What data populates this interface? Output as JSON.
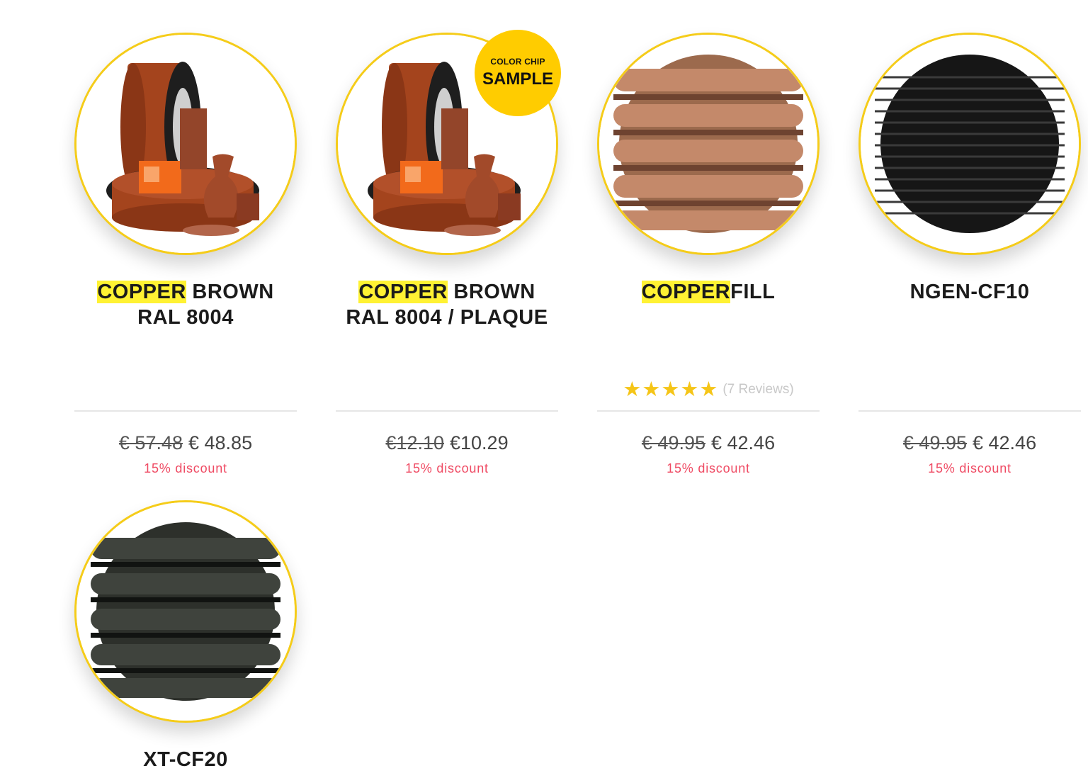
{
  "products": [
    {
      "image": "copper-brown-spool-photo",
      "title_highlight": "COPPER",
      "title_rest": " BROWN",
      "title_line2": "RAL 8004",
      "old_price": "€ 57.48",
      "new_price": "€ 48.85",
      "discount": "15% discount"
    },
    {
      "image": "copper-brown-spool-photo",
      "badge_top": "COLOR CHIP",
      "badge_main": "SAMPLE",
      "title_highlight": "COPPER",
      "title_rest": " BROWN",
      "title_line2": "RAL 8004 / PLAQUE",
      "old_price": "€12.10",
      "new_price": "€10.29",
      "discount": "15% discount"
    },
    {
      "image": "copper-filament-closeup",
      "title_highlight": "COPPER",
      "title_rest": "FILL",
      "rating_stars": 5,
      "reviews": "(7 Reviews)",
      "old_price": "€ 49.95",
      "new_price": "€ 42.46",
      "discount": "15% discount"
    },
    {
      "image": "black-filament-closeup",
      "title": "NGEN-CF10",
      "old_price": "€ 49.95",
      "new_price": "€ 42.46",
      "discount": "15% discount"
    },
    {
      "image": "dark-grey-filament-closeup",
      "title": "XT-CF20"
    }
  ],
  "colors": {
    "ring": "#f5cc19",
    "badge": "#ffcc00",
    "highlight": "#fff233",
    "discount": "#ef4a63",
    "stars": "#f5c518"
  }
}
